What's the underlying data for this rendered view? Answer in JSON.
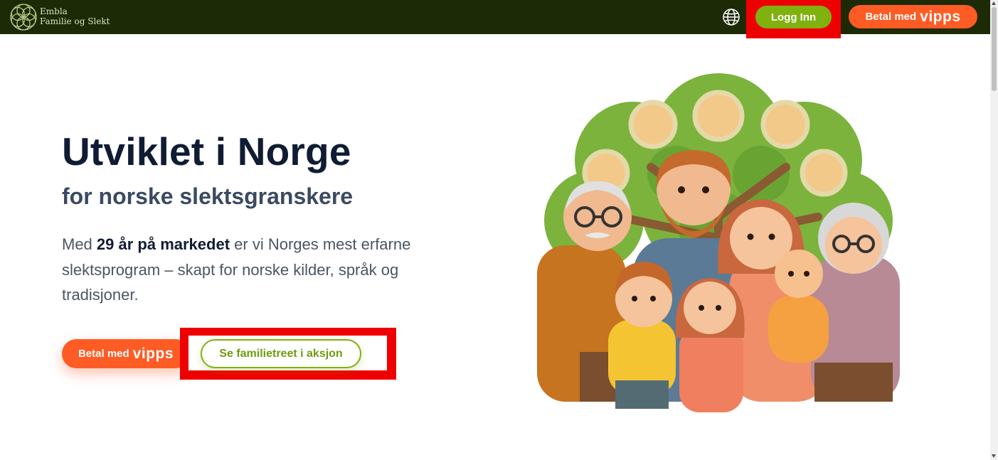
{
  "header": {
    "brand_line1": "Embla",
    "brand_line2": "Familie og Slekt",
    "logo_icon": "tree-of-life-logo-icon",
    "language_icon": "globe-icon",
    "login_label": "Logg Inn",
    "vipps_prefix": "Betal med",
    "vipps_brand": "vipps"
  },
  "hero": {
    "title": "Utviklet i Norge",
    "subtitle": "for norske slektsgranskere",
    "desc_pre": "Med ",
    "desc_bold": "29 år på markedet",
    "desc_post": " er vi Norges mest erfarne slektsprogram – skapt for norske kilder, språk og tradisjoner.",
    "vipps_prefix": "Betal med",
    "vipps_brand": "vipps",
    "demo_label": "Se familietreet i aksjon",
    "illustration_icon": "family-tree-illustration"
  },
  "colors": {
    "header_bg": "#1c2a06",
    "login_green": "#80b10f",
    "vipps_orange": "#ff5b24",
    "highlight_red": "#ee0000",
    "title": "#0f1c33"
  }
}
